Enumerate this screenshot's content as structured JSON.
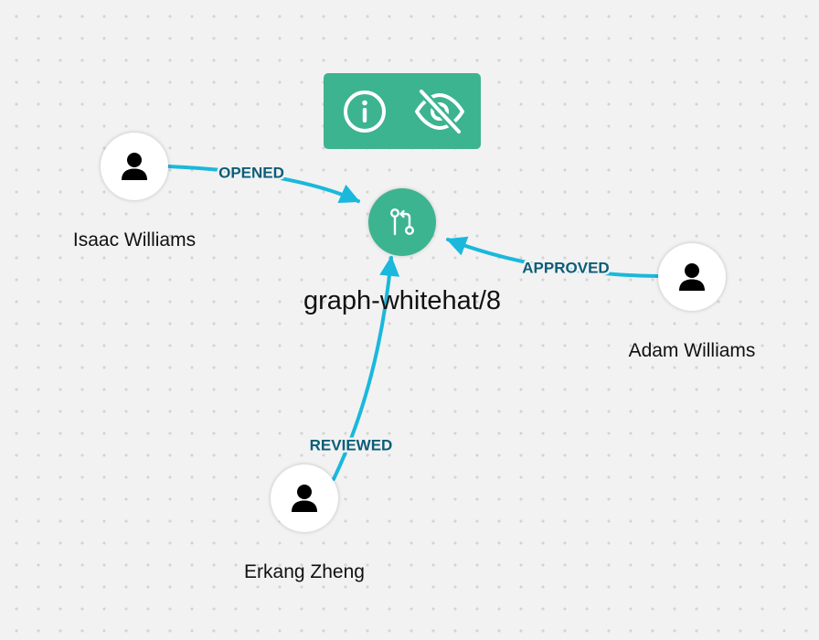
{
  "toolbar": {
    "info_icon": "info-circle-icon",
    "hide_icon": "eye-off-icon",
    "background": "#3cb48f"
  },
  "pr_node": {
    "label": "graph-whitehat/8",
    "icon": "pull-request-icon",
    "color": "#3cb48f"
  },
  "people": [
    {
      "name": "Isaac Williams",
      "icon": "person-icon"
    },
    {
      "name": "Adam Williams",
      "icon": "person-icon"
    },
    {
      "name": "Erkang Zheng",
      "icon": "person-icon"
    }
  ],
  "edges": [
    {
      "label": "OPENED",
      "from": "Isaac Williams",
      "to": "graph-whitehat/8"
    },
    {
      "label": "APPROVED",
      "from": "Adam Williams",
      "to": "graph-whitehat/8"
    },
    {
      "label": "REVIEWED",
      "from": "Erkang Zheng",
      "to": "graph-whitehat/8"
    }
  ],
  "colors": {
    "edge": "#1ab8dc",
    "edge_label": "#0b5d78",
    "canvas_background": "#f2f2f2",
    "canvas_dots": "#d4d4d4"
  }
}
